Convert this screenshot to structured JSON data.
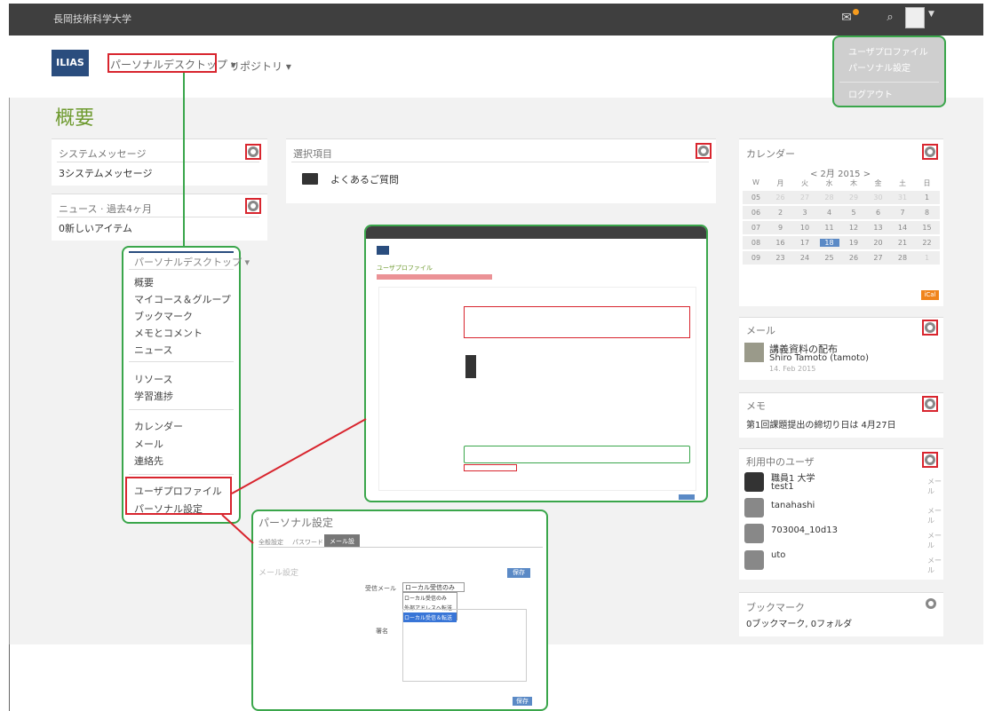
{
  "topbar": {
    "university": "長岡技術科学大学"
  },
  "nav": {
    "logo": "ILIAS",
    "personal_desktop": "パーソナルデスクトップ ▾",
    "repository": "リポジトリ ▾"
  },
  "user_dropdown": {
    "items": [
      "ユーザプロファイル",
      "パーソナル設定",
      "ログアウト"
    ]
  },
  "page_title": "概要",
  "panels": {
    "system_messages": {
      "title": "システムメッセージ",
      "body": "3システムメッセージ"
    },
    "news": {
      "title": "ニュース · 過去4ヶ月",
      "body": "0新しいアイテム"
    },
    "selected": {
      "title": "選択項目",
      "item": "よくあるご質問"
    },
    "calendar": {
      "title": "カレンダー",
      "month": "< 2月 2015 >",
      "headers": [
        "W",
        "月",
        "火",
        "水",
        "木",
        "金",
        "土",
        "日"
      ],
      "rows": [
        [
          "05",
          "26",
          "27",
          "28",
          "29",
          "30",
          "31",
          "1"
        ],
        [
          "06",
          "2",
          "3",
          "4",
          "5",
          "6",
          "7",
          "8"
        ],
        [
          "07",
          "9",
          "10",
          "11",
          "12",
          "13",
          "14",
          "15"
        ],
        [
          "08",
          "16",
          "17",
          "18",
          "19",
          "20",
          "21",
          "22"
        ],
        [
          "09",
          "23",
          "24",
          "25",
          "26",
          "27",
          "28",
          "1"
        ]
      ],
      "ical": "iCal"
    },
    "mail": {
      "title": "メール",
      "subject": "講義資料の配布",
      "sender": "Shiro Tamoto (tamoto)",
      "date": "14. Feb 2015"
    },
    "memo": {
      "title": "メモ",
      "body": "第1回課題提出の締切り日は 4月27日"
    },
    "online_users": {
      "title": "利用中のユーザ",
      "users": [
        {
          "name": "職員1 大学",
          "login": "test1",
          "action": "メール"
        },
        {
          "name": "tanahashi",
          "action": "メール"
        },
        {
          "name": "703004_10d13",
          "action": "メール"
        },
        {
          "name": "uto",
          "action": "メール"
        }
      ]
    },
    "bookmarks": {
      "title": "ブックマーク",
      "body": "0ブックマーク, 0フォルダ"
    }
  },
  "menu": {
    "header": "パーソナルデスクトップ ▾",
    "groups": [
      [
        "概要",
        "マイコース＆グループ",
        "ブックマーク",
        "メモとコメント",
        "ニュース"
      ],
      [
        "リソース",
        "学習進捗"
      ],
      [
        "カレンダー",
        "メール",
        "連絡先"
      ],
      [
        "ユーザプロファイル",
        "パーソナル設定"
      ]
    ]
  },
  "profile_shot": {
    "title": "ユーザプロファイル"
  },
  "personal_settings": {
    "title": "パーソナル設定",
    "tabs": [
      "全般設定",
      "パスワード",
      "メール設定"
    ],
    "section": "メール設定",
    "save": "保存",
    "fields": {
      "incoming": "受信メール",
      "signature": "署名",
      "incoming_value": "ローカル受信のみ"
    },
    "options": [
      "ローカル受信のみ",
      "外部アドレスへ転送",
      "ローカル受信＆転送"
    ]
  },
  "colors": {
    "accent_green": "#3aa64b",
    "highlight_red": "#d8252e",
    "title_green": "#6e9a2f",
    "logo_blue": "#2a4d7e"
  }
}
